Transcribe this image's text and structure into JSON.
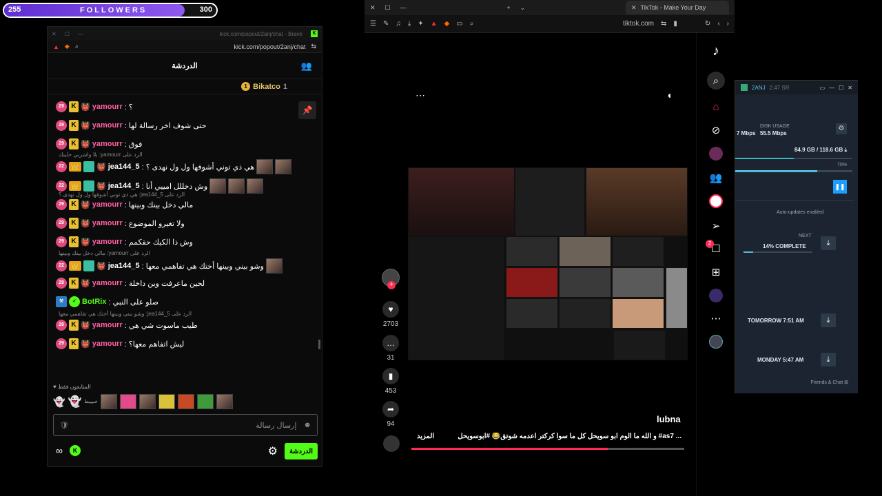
{
  "followers": {
    "current": "255",
    "label": "FOLLOWERS",
    "goal": "300",
    "progress": 0.85
  },
  "kick": {
    "window_url_title": "kick.com/popout/2anj/chat - Brave",
    "address": "kick.com/popout/2anj/chat",
    "chat_title": "الدردشة",
    "pinned_user": "Bikatco",
    "pinned_count": "1",
    "messages": [
      {
        "badge": "29",
        "user": "yamourr",
        "text": ": ؟"
      },
      {
        "badge": "29",
        "user": "yamourr",
        "text": ": حتى شوف اخر رسالة لها"
      },
      {
        "badge": "29",
        "user": "yamourr",
        "text": ": فوق"
      },
      {
        "badge": "22",
        "user": "jea144_5",
        "text": ": هي ذي توني أشوفها ول ول نهدى ؟"
      },
      {
        "badge": "22",
        "user": "jea144_5",
        "text": ": وش دخللل امييي أنا"
      },
      {
        "badge": "29",
        "user": "yamourr",
        "text": ": مالي دخل بينك وبينها"
      },
      {
        "badge": "29",
        "user": "yamourr",
        "text": ": ولا تغيرو الموضوع"
      },
      {
        "badge": "29",
        "user": "yamourr",
        "text": ": وش ذا الكيك حقكمم"
      },
      {
        "badge": "22",
        "user": "jea144_5",
        "text": ": وشو بيني وبينها أختك هي تفاهمي معها"
      },
      {
        "badge": "29",
        "user": "yamourr",
        "text": ": لحين ماعرفت وين داخلة"
      },
      {
        "badge": "",
        "user": "BotRix",
        "text": ": صلو على النبي"
      },
      {
        "badge": "29",
        "user": "yamourr",
        "text": ": طيب ماسوت شي هي"
      },
      {
        "badge": "29",
        "user": "yamourr",
        "text": ": ليش اتفاهم معها؟"
      }
    ],
    "replies": [
      "بلا واشربي حليبك :yamourr الرد على",
      "هي ذي توني أشوفها ول ول نهدى ؟ :jea144_5 الرد على",
      "مالي دخل بينك وبينها :yamourr الرد على",
      "وشو بيني وبينها أختك هي تفاهمي معها :jea144_5 الرد على"
    ],
    "followers_only": "المتابعون فقط",
    "emote_text": "خبيييط",
    "input_placeholder": "إرسال رسالة",
    "send_label": "الدردشة"
  },
  "browser": {
    "tab_title": "TikTok - Make Your Day",
    "address": "tiktok.com",
    "likes": "2703",
    "comments": "31",
    "saves": "453",
    "shares": "94",
    "author": "lubna",
    "caption": "و الله ما الوم ابو سويحل كل ما سوا كركتر اعدمه شوتق😂 #ابوسويحل #as7 ...",
    "more": "المزيد",
    "inbox_badge": "2"
  },
  "steam": {
    "user": "2ANJ",
    "balance": "2.47 SR",
    "net": "7 Mbps",
    "disk_label": "DISK USAGE",
    "disk_speed": "55.5 Mbps",
    "size": "84.9 GB / 118.6 GB",
    "percent": "70%",
    "autoupdates": "Auto-updates enabled",
    "next_label": "NEXT",
    "next_progress": "14% COMPLETE",
    "tomorrow": "TOMORROW 7:51 AM",
    "monday": "MONDAY 5:47 AM",
    "friends": "Friends & Chat"
  },
  "colors": {
    "kick_green": "#53fc18",
    "tiktok_red": "#fe2c55",
    "yamourr": "#ff5fa2",
    "botrix": "#53fc18",
    "jea": "#ffffff"
  }
}
